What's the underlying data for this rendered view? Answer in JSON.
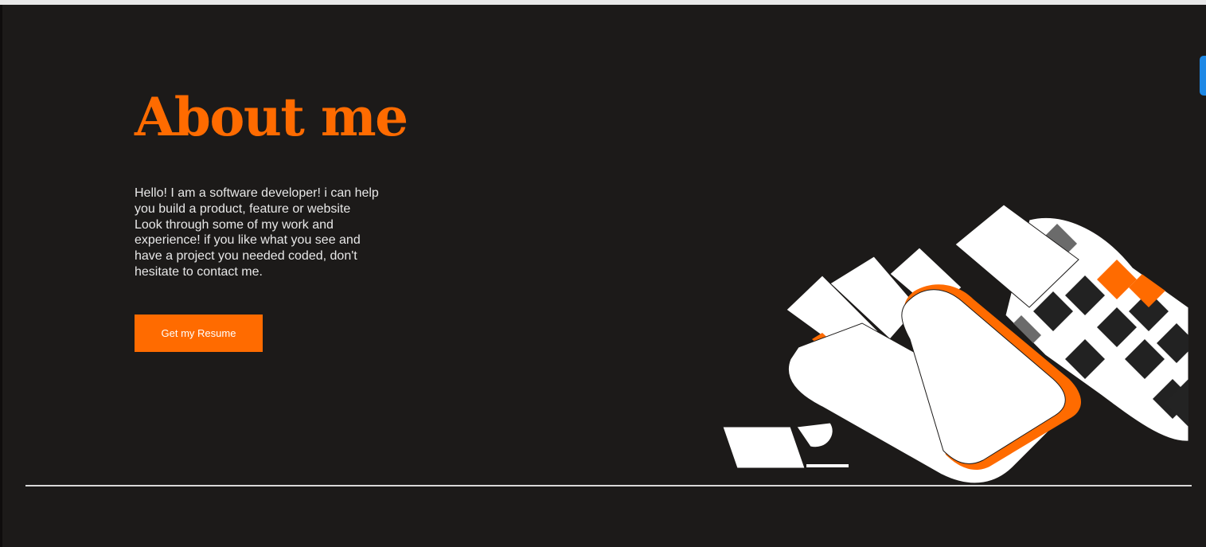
{
  "about": {
    "title": "About me",
    "bio_lines": [
      "Hello! I am a software developer! i can help",
      "you build a product, feature or website",
      "Look through some of my work and",
      "experience! if you like what you see and",
      "have a project you needed coded, don't",
      "hesitate to contact me."
    ],
    "resume_button": "Get my Resume"
  },
  "colors": {
    "accent": "#ff6b00",
    "background": "#1c1a19",
    "text": "#e8e8e8",
    "side_tab": "#1e88e5"
  },
  "illustration": {
    "name": "abstract-3d-letters-illustration"
  }
}
